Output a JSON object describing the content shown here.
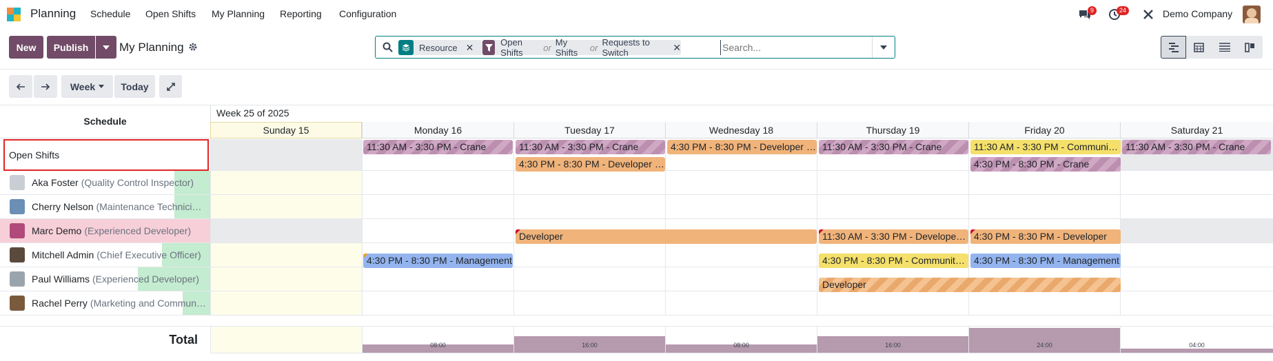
{
  "nav": {
    "app_name": "Planning",
    "menu": [
      "Schedule",
      "Open Shifts",
      "My Planning",
      "Reporting",
      "Configuration"
    ],
    "chat_count": "9",
    "activity_count": "24",
    "company": "Demo Company"
  },
  "control": {
    "new_label": "New",
    "publish_label": "Publish",
    "view_title": "My Planning",
    "search": {
      "facet1_label": "Resource",
      "facet2_values": [
        "Open Shifts",
        "My Shifts",
        "Requests to Switch"
      ],
      "or_label": "or",
      "placeholder": "Search..."
    },
    "week_label": "Week",
    "today_label": "Today"
  },
  "grid": {
    "row_header_label": "Schedule",
    "week_label": "Week 25 of 2025",
    "days": [
      "Sunday 15",
      "Monday 16",
      "Tuesday 17",
      "Wednesday 18",
      "Thursday 19",
      "Friday 20",
      "Saturday 21"
    ],
    "open_shifts_label": "Open Shifts",
    "rows": [
      {
        "name": "Aka Foster",
        "role": "(Quality Control Inspector)"
      },
      {
        "name": "Cherry Nelson",
        "role": "(Maintenance Technici…"
      },
      {
        "name": "Marc Demo",
        "role": "(Experienced Developer)"
      },
      {
        "name": "Mitchell Admin",
        "role": "(Chief Executive Officer)"
      },
      {
        "name": "Paul Williams",
        "role": "(Experienced Developer)"
      },
      {
        "name": "Rachel Perry",
        "role": "(Marketing and Commun…"
      }
    ],
    "shifts": {
      "open_mon": "11:30 AM - 3:30 PM - Crane",
      "open_tue1": "11:30 AM - 3:30 PM - Crane",
      "open_tue2": "4:30 PM - 8:30 PM - Developer …",
      "open_wed": "4:30 PM - 8:30 PM - Developer …",
      "open_thu": "11:30 AM - 3:30 PM - Crane",
      "open_fri1": "11:30 AM - 3:30 PM - Communi…",
      "open_fri2": "4:30 PM - 8:30 PM - Crane",
      "open_sat": "11:30 AM - 3:30 PM - Crane",
      "marc_tue": "Developer",
      "marc_thu": "11:30 AM - 3:30 PM - Develope…",
      "marc_fri": "4:30 PM - 8:30 PM - Developer",
      "mitchell_mon": "4:30 PM - 8:30 PM - Management",
      "mitchell_thu": "4:30 PM - 8:30 PM - Communit…",
      "mitchell_fri": "4:30 PM - 8:30 PM - Management",
      "paul_thu": "Developer"
    },
    "total_label": "Total",
    "totals": [
      "",
      "08:00",
      "16:00",
      "08:00",
      "16:00",
      "24:00",
      "04:00"
    ],
    "total_fractions": [
      0,
      0.33,
      0.67,
      0.33,
      0.67,
      1,
      0.17
    ]
  },
  "colors": {
    "primary": "#714b67",
    "accent": "#017e84"
  }
}
